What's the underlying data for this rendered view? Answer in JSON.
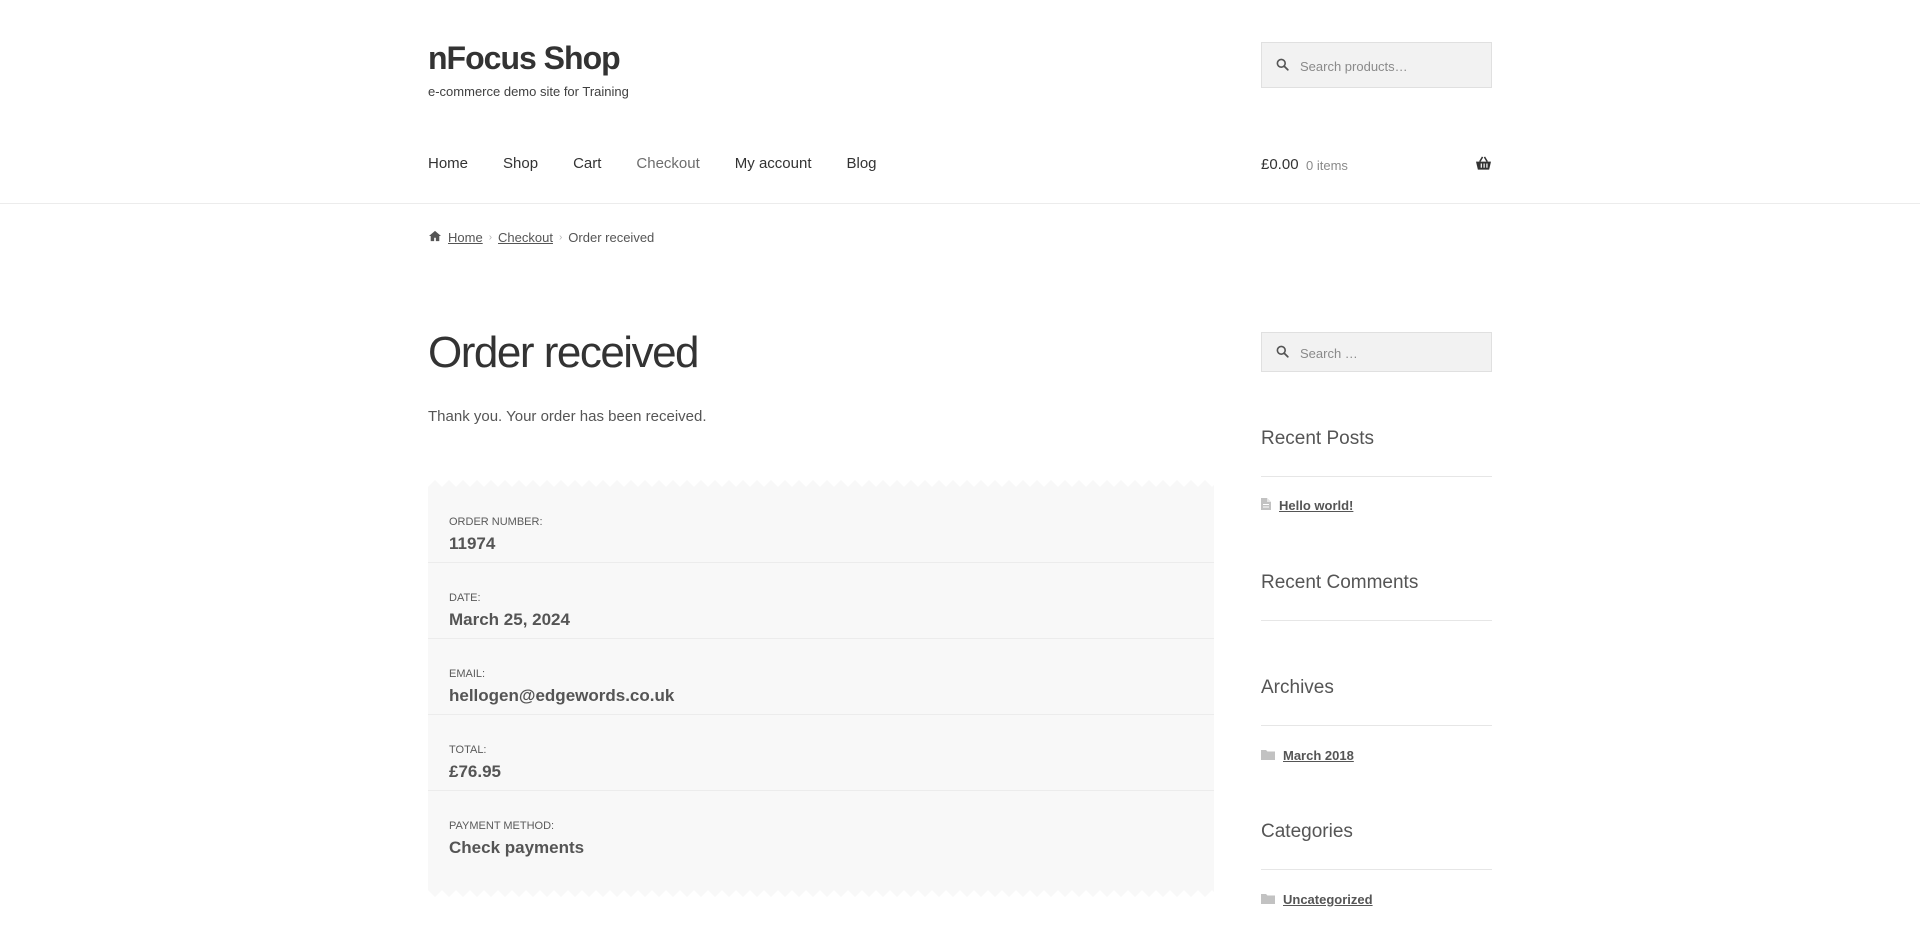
{
  "site": {
    "title": "nFocus Shop",
    "tagline": "e-commerce demo site for Training"
  },
  "header": {
    "search_placeholder": "Search products…"
  },
  "nav": [
    {
      "label": "Home"
    },
    {
      "label": "Shop"
    },
    {
      "label": "Cart"
    },
    {
      "label": "Checkout",
      "current": true
    },
    {
      "label": "My account"
    },
    {
      "label": "Blog"
    }
  ],
  "cart": {
    "amount": "£0.00",
    "count": "0 items"
  },
  "breadcrumb": {
    "home": "Home",
    "checkout": "Checkout",
    "current": "Order received"
  },
  "main": {
    "title": "Order received",
    "thankyou": "Thank you. Your order has been received.",
    "order": [
      {
        "label": "ORDER NUMBER:",
        "value": "11974"
      },
      {
        "label": "DATE:",
        "value": "March 25, 2024"
      },
      {
        "label": "EMAIL:",
        "value": "hellogen@edgewords.co.uk"
      },
      {
        "label": "TOTAL:",
        "value": "£76.95"
      },
      {
        "label": "PAYMENT METHOD:",
        "value": "Check payments"
      }
    ]
  },
  "sidebar": {
    "search_placeholder": "Search …",
    "recent_posts": {
      "title": "Recent Posts",
      "items": [
        "Hello world!"
      ]
    },
    "recent_comments": {
      "title": "Recent Comments"
    },
    "archives": {
      "title": "Archives",
      "items": [
        "March 2018"
      ]
    },
    "categories": {
      "title": "Categories",
      "items": [
        "Uncategorized"
      ]
    }
  },
  "colors": {
    "text": "#43454b",
    "panel": "#f8f8f8",
    "border": "#ececec"
  },
  "icons": [
    "search-icon",
    "basket-icon",
    "home-icon",
    "document-icon",
    "folder-icon"
  ]
}
